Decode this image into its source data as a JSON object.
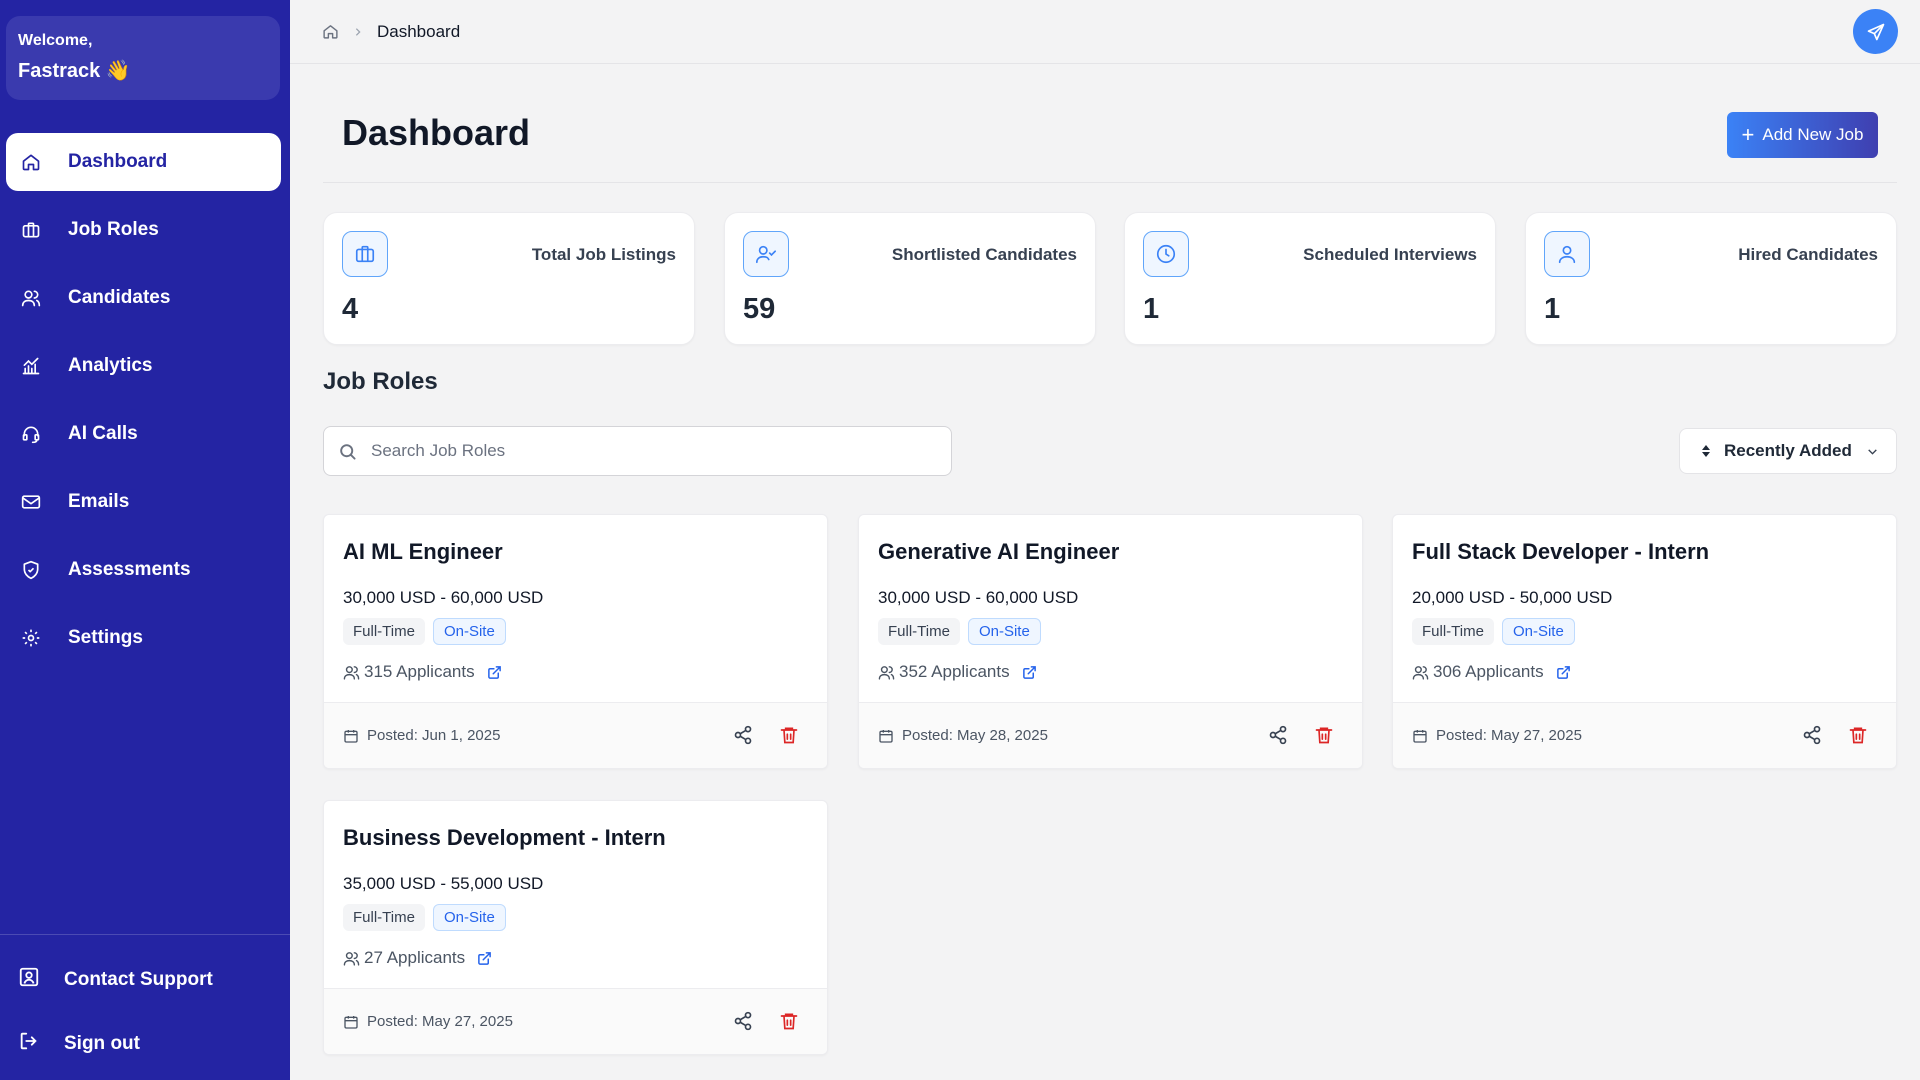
{
  "sidebar": {
    "welcome_label": "Welcome,",
    "user_name": "Fastrack 👋",
    "items": [
      {
        "label": "Dashboard",
        "icon": "home-icon",
        "active": true
      },
      {
        "label": "Job Roles",
        "icon": "briefcase-icon"
      },
      {
        "label": "Candidates",
        "icon": "users-icon"
      },
      {
        "label": "Analytics",
        "icon": "chart-icon"
      },
      {
        "label": "AI Calls",
        "icon": "headset-icon"
      },
      {
        "label": "Emails",
        "icon": "mail-icon"
      },
      {
        "label": "Assessments",
        "icon": "shield-check-icon"
      },
      {
        "label": "Settings",
        "icon": "gear-icon"
      }
    ],
    "contact_support": "Contact Support",
    "sign_out": "Sign out"
  },
  "header": {
    "breadcrumb_current": "Dashboard"
  },
  "page": {
    "title": "Dashboard",
    "add_job_label": "Add New Job"
  },
  "stats": [
    {
      "label": "Total Job Listings",
      "value": "4",
      "icon": "briefcase-icon"
    },
    {
      "label": "Shortlisted Candidates",
      "value": "59",
      "icon": "user-check-icon"
    },
    {
      "label": "Scheduled Interviews",
      "value": "1",
      "icon": "clock-icon"
    },
    {
      "label": "Hired Candidates",
      "value": "1",
      "icon": "user-icon"
    }
  ],
  "job_roles": {
    "section_title": "Job Roles",
    "search_placeholder": "Search Job Roles",
    "sort_label": "Recently Added",
    "jobs": [
      {
        "title": "AI ML Engineer",
        "salary": "30,000 USD - 60,000 USD",
        "type": "Full-Time",
        "location": "On-Site",
        "applicants": "315 Applicants",
        "posted": "Posted: Jun 1, 2025"
      },
      {
        "title": "Generative AI Engineer",
        "salary": "30,000 USD - 60,000 USD",
        "type": "Full-Time",
        "location": "On-Site",
        "applicants": "352 Applicants",
        "posted": "Posted: May 28, 2025"
      },
      {
        "title": "Full Stack Developer - Intern",
        "salary": "20,000 USD - 50,000 USD",
        "type": "Full-Time",
        "location": "On-Site",
        "applicants": "306 Applicants",
        "posted": "Posted: May 27, 2025"
      },
      {
        "title": "Business Development - Intern",
        "salary": "35,000 USD - 55,000 USD",
        "type": "Full-Time",
        "location": "On-Site",
        "applicants": "27 Applicants",
        "posted": "Posted: May 27, 2025"
      }
    ]
  },
  "colors": {
    "sidebar_bg": "#2424a3",
    "accent_blue": "#3b82f6",
    "delete_red": "#dc2626"
  }
}
